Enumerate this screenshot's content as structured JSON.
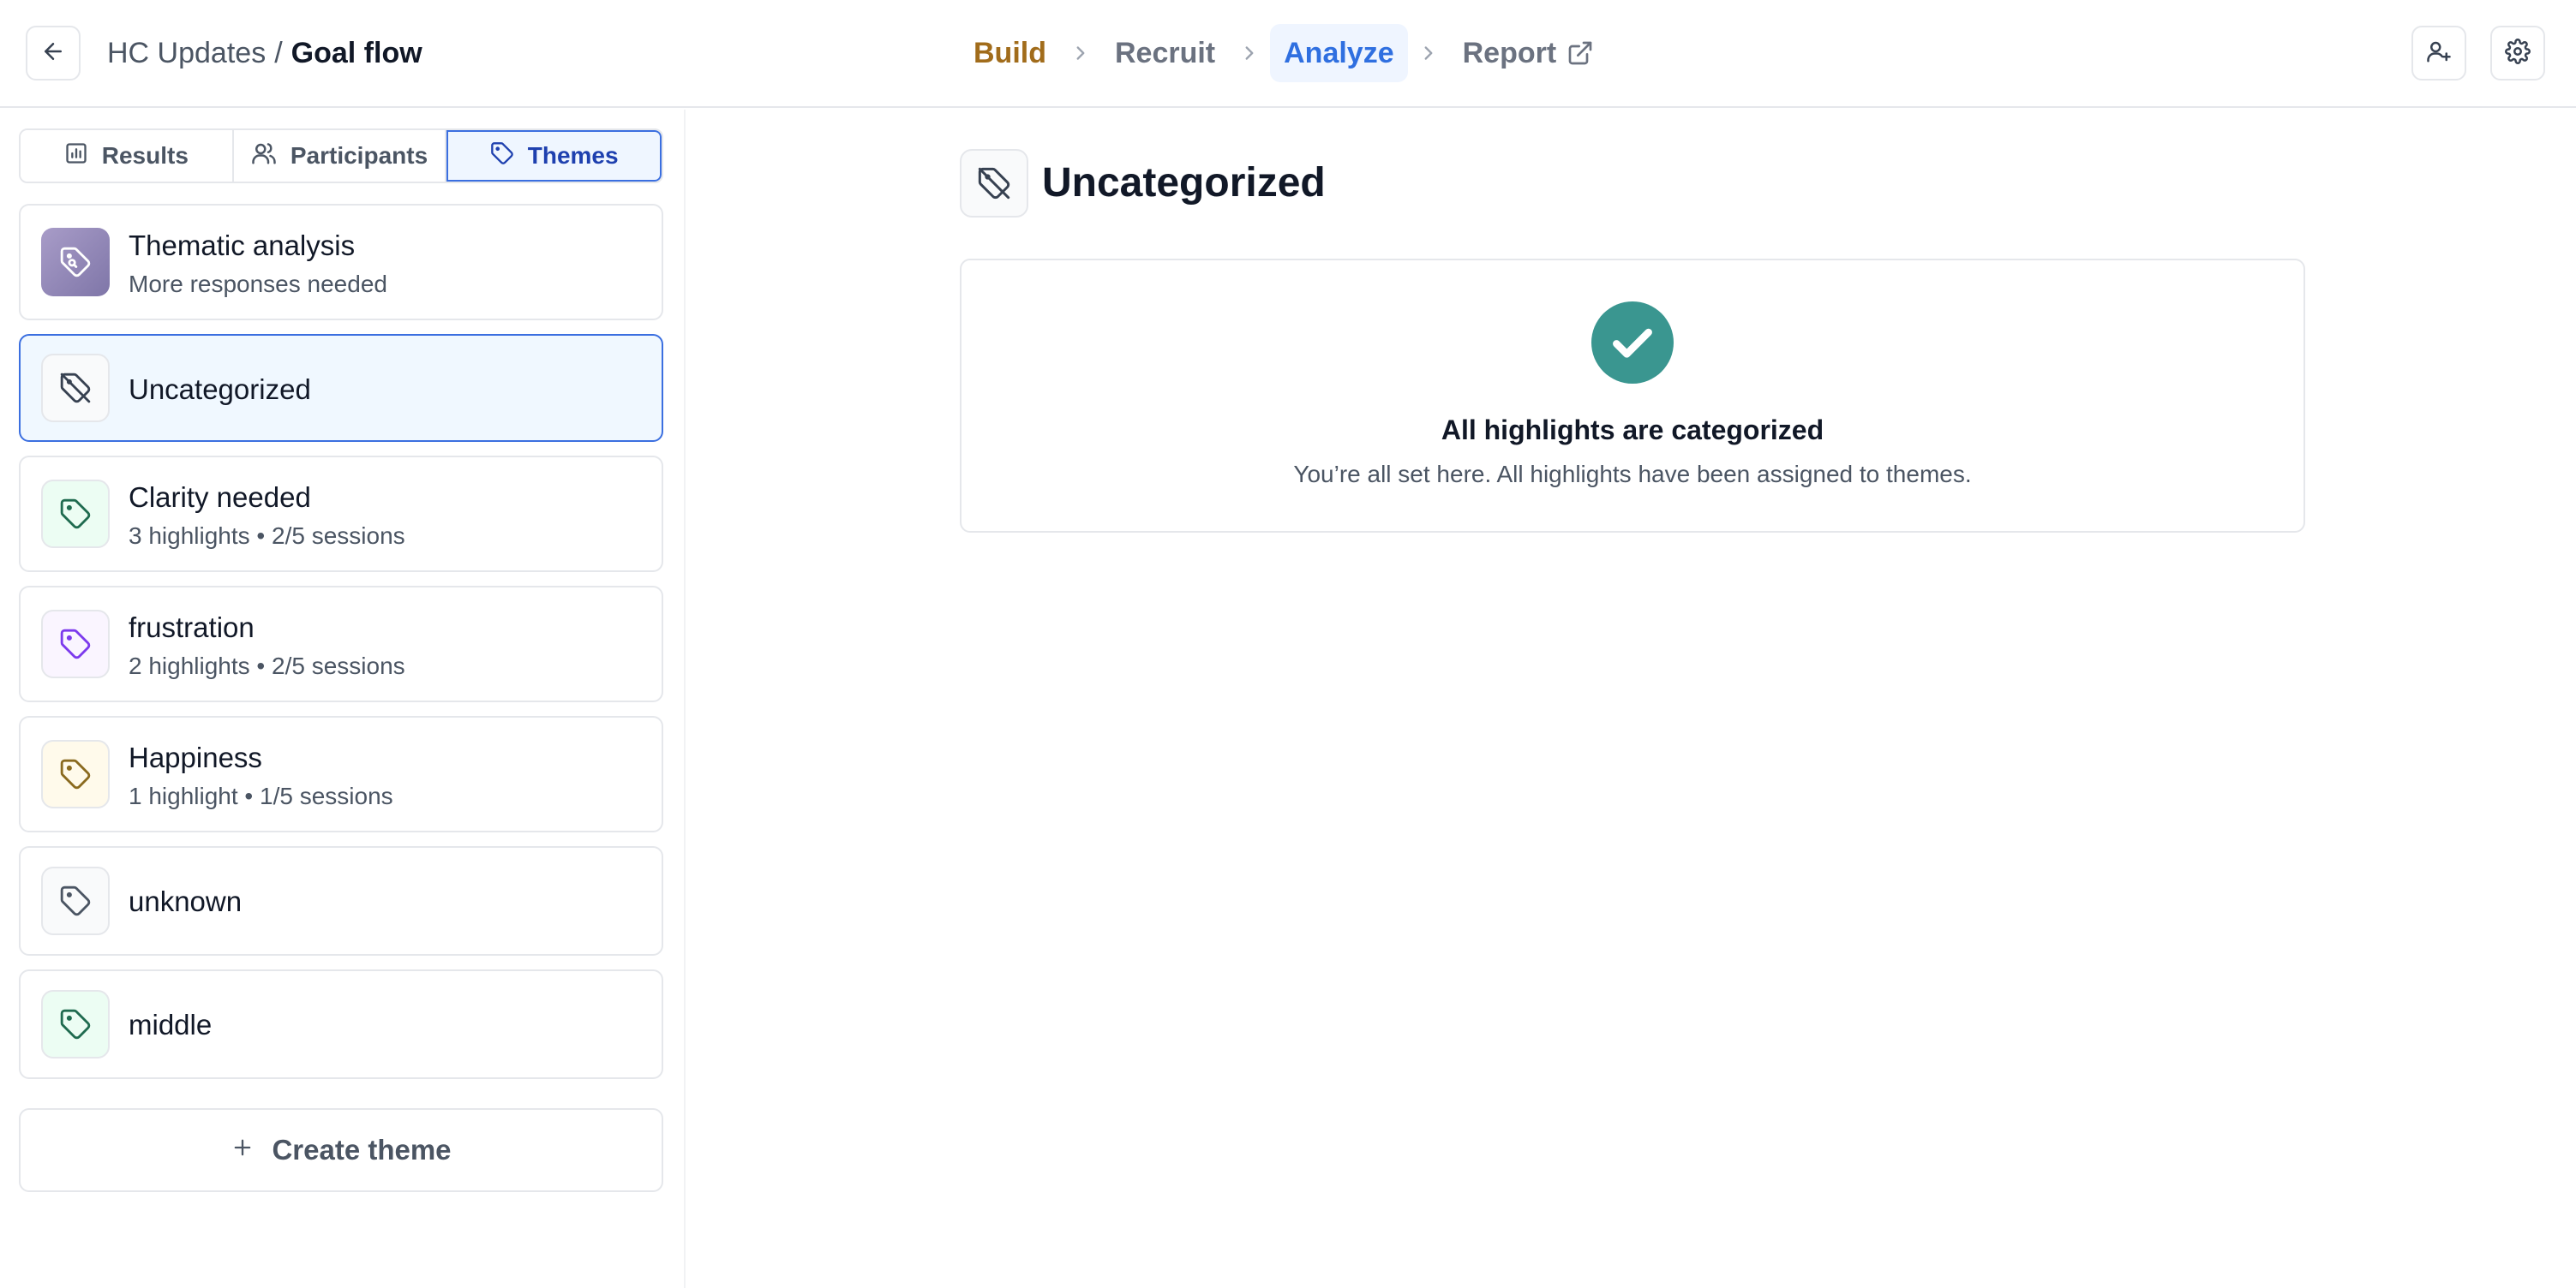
{
  "breadcrumb": {
    "parent": "HC Updates",
    "separator": "/",
    "current": "Goal flow"
  },
  "steps": {
    "build": "Build",
    "recruit": "Recruit",
    "analyze": "Analyze",
    "report": "Report",
    "active": "Analyze"
  },
  "sidebar": {
    "tabs": {
      "results": "Results",
      "participants": "Participants",
      "themes": "Themes",
      "active": "Themes"
    },
    "items": [
      {
        "title": "Thematic analysis",
        "subtitle": "More responses needed",
        "icon": "tag-search-icon"
      },
      {
        "title": "Uncategorized",
        "subtitle": "",
        "icon": "tag-off-icon",
        "selected": true
      },
      {
        "title": "Clarity needed",
        "subtitle": "3 highlights • 2/5 sessions",
        "icon": "tag-icon",
        "color": "#1f6b4f"
      },
      {
        "title": "frustration",
        "subtitle": "2 highlights • 2/5 sessions",
        "icon": "tag-icon",
        "color": "#7c3aed"
      },
      {
        "title": "Happiness",
        "subtitle": "1 highlight • 1/5 sessions",
        "icon": "tag-icon",
        "color": "#8a6a1f"
      },
      {
        "title": "unknown",
        "subtitle": "",
        "icon": "tag-icon",
        "color": "#4b5563"
      },
      {
        "title": "middle",
        "subtitle": "",
        "icon": "tag-icon",
        "color": "#1f6b4f"
      }
    ],
    "create_label": "Create theme"
  },
  "main": {
    "title": "Uncategorized",
    "empty_title": "All highlights are categorized",
    "empty_subtitle": "You’re all set here. All highlights have been assigned to themes."
  },
  "colors": {
    "accent_blue": "#2f6fe0",
    "build_gold": "#a16c1b",
    "check_teal": "#3a9690"
  }
}
